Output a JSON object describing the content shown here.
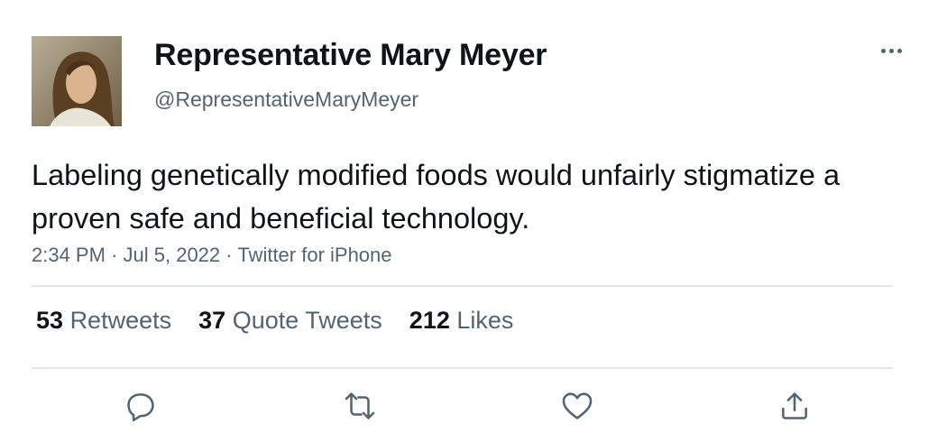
{
  "user": {
    "display_name": "Representative Mary Meyer",
    "handle": "@RepresentativeMaryMeyer",
    "avatar_icon": "profile-photo"
  },
  "tweet": {
    "text": "Labeling genetically modified foods would unfairly stigmatize a proven safe and beneficial technology.",
    "time": "2:34 PM",
    "date": "Jul 5, 2022",
    "source": "Twitter for iPhone",
    "separator": "·"
  },
  "stats": {
    "retweets": {
      "count": "53",
      "label": "Retweets"
    },
    "quotes": {
      "count": "37",
      "label": "Quote Tweets"
    },
    "likes": {
      "count": "212",
      "label": "Likes"
    }
  },
  "actions": [
    "reply-icon",
    "retweet-icon",
    "like-icon",
    "share-icon"
  ],
  "colors": {
    "text_primary": "#0f1419",
    "text_secondary": "#536471",
    "divider": "#e1e6ea"
  }
}
